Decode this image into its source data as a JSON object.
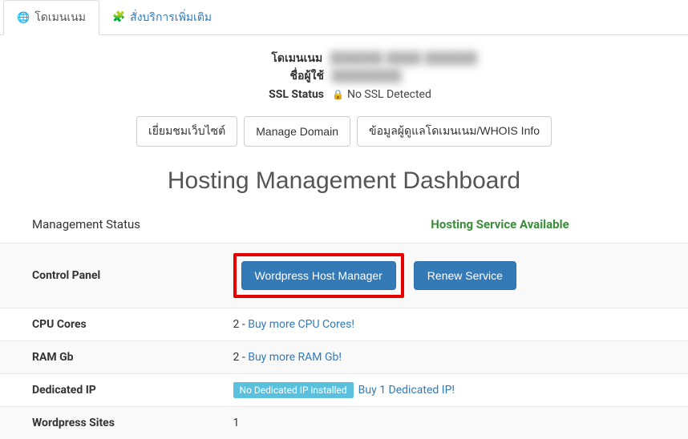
{
  "tabs": {
    "domain": "โดเมนเนม",
    "addon": "สั่งบริการเพิ่มเติม"
  },
  "info": {
    "domain_label": "โดเมนเนม",
    "domain_value": "██████ ████ ██████",
    "user_label": "ชื่อผู้ใช้",
    "user_value": "████████",
    "ssl_label": "SSL Status",
    "ssl_value": "No SSL Detected"
  },
  "buttons": {
    "visit": "เยี่ยมชมเว็บไซต์",
    "manage": "Manage Domain",
    "whois": "ข้อมูลผู้ดูแลโดเมนเนม/WHOIS Info"
  },
  "dashboard": {
    "title": "Hosting Management Dashboard",
    "status_label": "Management Status",
    "status_value": "Hosting Service Available"
  },
  "rows": {
    "control_panel_label": "Control Panel",
    "wordpress_btn": "Wordpress Host Manager",
    "renew_btn": "Renew Service",
    "cpu_label": "CPU Cores",
    "cpu_value": "2 - ",
    "cpu_link": "Buy more CPU Cores!",
    "ram_label": "RAM Gb",
    "ram_value": "2 - ",
    "ram_link": "Buy more RAM Gb!",
    "ip_label": "Dedicated IP",
    "ip_badge": "No Dedicated IP installed",
    "ip_link": "Buy 1 Dedicated IP!",
    "wp_label": "Wordpress Sites",
    "wp_value": "1"
  }
}
